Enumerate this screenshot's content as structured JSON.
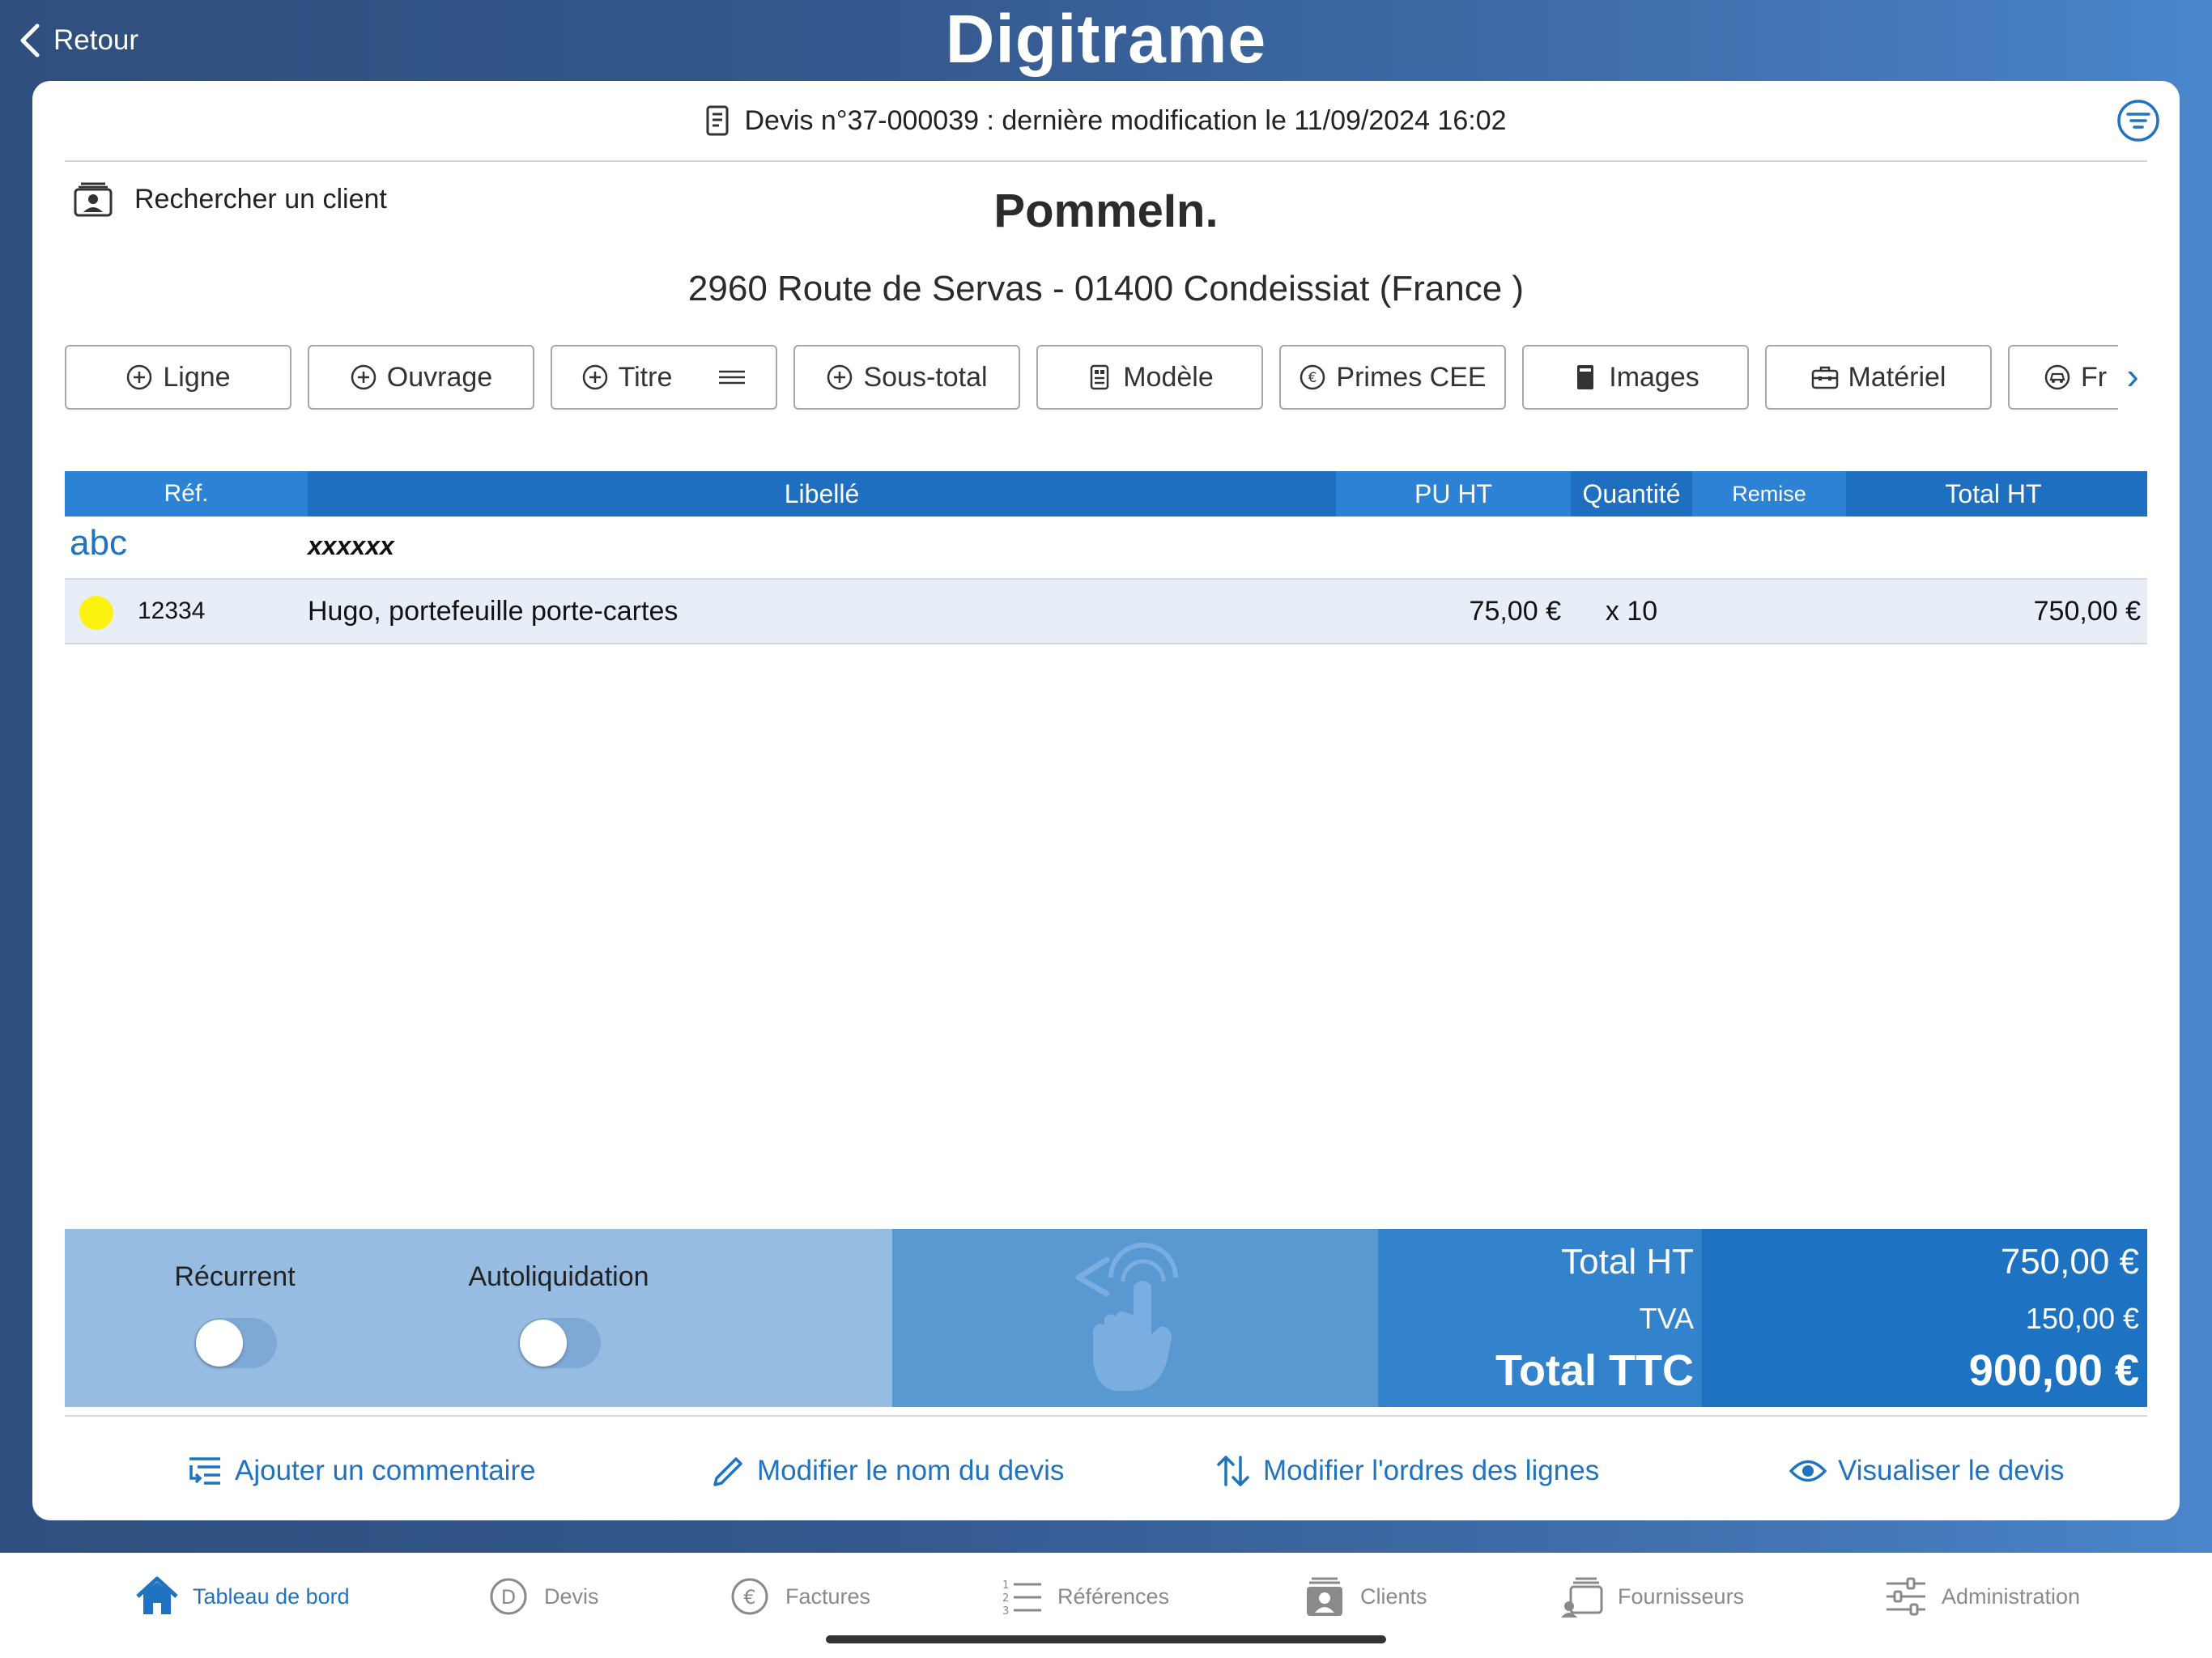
{
  "header": {
    "back_label": "Retour",
    "app_title": "Digitrame"
  },
  "document": {
    "title": "Devis n°37-000039 : dernière modification le 11/09/2024 16:02"
  },
  "client": {
    "search_label": "Rechercher un client",
    "name": "PommeIn.",
    "address": "2960 Route de Servas - 01400 Condeissiat (France )"
  },
  "toolbar": {
    "buttons": [
      {
        "label": "Ligne",
        "icon": "plus-circle-icon"
      },
      {
        "label": "Ouvrage",
        "icon": "plus-circle-icon"
      },
      {
        "label": "Titre",
        "icon": "plus-circle-icon"
      },
      {
        "label": "Sous-total",
        "icon": "plus-circle-icon"
      },
      {
        "label": "Modèle",
        "icon": "template-icon"
      },
      {
        "label": "Primes CEE",
        "icon": "euro-circle-icon"
      },
      {
        "label": "Images",
        "icon": "image-icon"
      },
      {
        "label": "Matériel",
        "icon": "toolbox-icon"
      },
      {
        "label": "Fr",
        "icon": "car-icon"
      }
    ],
    "scroll_label": "›"
  },
  "table": {
    "columns": {
      "ref": "Réf.",
      "libelle": "Libellé",
      "pu_ht": "PU HT",
      "quantite": "Quantité",
      "remise": "Remise",
      "total_ht": "Total HT"
    },
    "title_row": {
      "tag": "abc",
      "text": "xxxxxx"
    },
    "rows": [
      {
        "ref": "12334",
        "libelle": "Hugo, portefeuille porte-cartes",
        "pu_ht": "75,00 €",
        "quantite": "x 10",
        "remise": "",
        "total_ht": "750,00 €",
        "status_color": "#fbf20f"
      }
    ]
  },
  "options": {
    "recurrent_label": "Récurrent",
    "recurrent_on": false,
    "autoliquidation_label": "Autoliquidation",
    "autoliquidation_on": false
  },
  "totals": {
    "ht_label": "Total HT",
    "ht_value": "750,00 €",
    "tva_label": "TVA",
    "tva_value": "150,00 €",
    "ttc_label": "Total TTC",
    "ttc_value": "900,00 €"
  },
  "actions": {
    "comment": "Ajouter un commentaire",
    "rename": "Modifier le nom du devis",
    "reorder": "Modifier l'ordres des lignes",
    "preview": "Visualiser le devis"
  },
  "tabs": [
    {
      "label": "Tableau de bord",
      "icon": "home-icon",
      "active": true
    },
    {
      "label": "Devis",
      "icon": "devis-icon",
      "active": false
    },
    {
      "label": "Factures",
      "icon": "euro-circle-icon",
      "active": false
    },
    {
      "label": "Références",
      "icon": "numbered-list-icon",
      "active": false
    },
    {
      "label": "Clients",
      "icon": "clients-icon",
      "active": false
    },
    {
      "label": "Fournisseurs",
      "icon": "suppliers-icon",
      "active": false
    },
    {
      "label": "Administration",
      "icon": "sliders-icon",
      "active": false
    }
  ],
  "colors": {
    "accent": "#1f73c0",
    "table_header": "#1f6fc0",
    "row_highlight": "#e7eef8",
    "status_dot": "#fbf20f"
  }
}
